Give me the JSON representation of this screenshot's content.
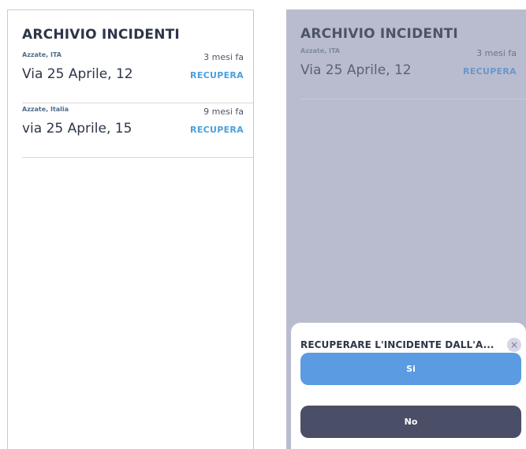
{
  "left": {
    "title": "ARCHIVIO INCIDENTI",
    "items": [
      {
        "location": "Azzate, ITA",
        "time": "3 mesi fa",
        "address": "Via 25 Aprile, 12",
        "action": "RECUPERA"
      },
      {
        "location": "Azzate, Italia",
        "time": "9 mesi fa",
        "address": "via 25 Aprile, 15",
        "action": "RECUPERA"
      }
    ]
  },
  "right": {
    "title": "ARCHIVIO INCIDENTI",
    "items": [
      {
        "location": "Azzate, ITA",
        "time": "3 mesi fa",
        "address": "Via 25 Aprile, 12",
        "action": "RECUPERA"
      }
    ],
    "dialog": {
      "title": "RECUPERARE L'INCIDENTE DALL'A...",
      "close_icon": "×",
      "yes_label": "Si",
      "no_label": "No"
    }
  },
  "colors": {
    "accent": "#4aa0dd",
    "overlay": "#b9bccf",
    "yes_button": "#5b9be2",
    "no_button": "#4a4e66",
    "text_dark": "#2e3548"
  }
}
